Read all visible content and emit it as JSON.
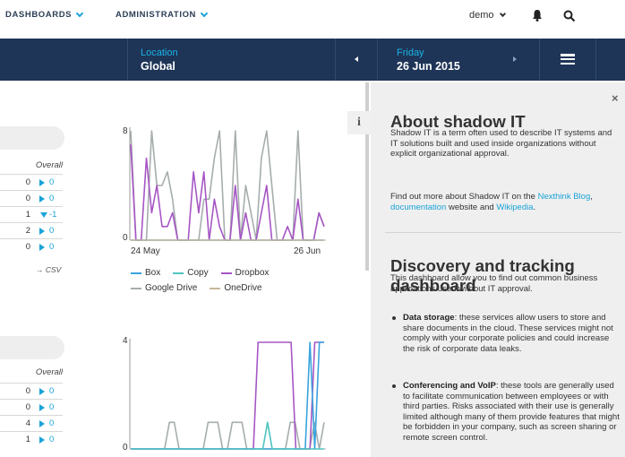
{
  "topnav": {
    "dashboards": "DASHBOARDS",
    "administration": "ADMINISTRATION",
    "user": "demo"
  },
  "header": {
    "location_label": "Location",
    "location_value": "Global",
    "date_day": "Friday",
    "date_value": "26 Jun 2015"
  },
  "table1": {
    "overall": "Overall",
    "rows": [
      {
        "value": "0",
        "dir": "right",
        "delta": "0"
      },
      {
        "value": "0",
        "dir": "right",
        "delta": "0"
      },
      {
        "value": "1",
        "dir": "down",
        "delta": "-1"
      },
      {
        "value": "2",
        "dir": "right",
        "delta": "0"
      },
      {
        "value": "0",
        "dir": "right",
        "delta": "0"
      }
    ],
    "csv": "→ CSV"
  },
  "table2": {
    "overall": "Overall",
    "rows": [
      {
        "value": "0",
        "dir": "right",
        "delta": "0"
      },
      {
        "value": "0",
        "dir": "right",
        "delta": "0"
      },
      {
        "value": "4",
        "dir": "right",
        "delta": "0"
      },
      {
        "value": "1",
        "dir": "right",
        "delta": "0"
      }
    ]
  },
  "chart1": {
    "y_max_label": "8",
    "y_min_label": "0",
    "x_start_label": "24 May",
    "x_end_label": "26 Jun",
    "legend": [
      {
        "name": "Box",
        "color": "#3aa3dd"
      },
      {
        "name": "Copy",
        "color": "#4ec3c0"
      },
      {
        "name": "Dropbox",
        "color": "#a656c4"
      },
      {
        "name": "Google Drive",
        "color": "#a6adad"
      },
      {
        "name": "OneDrive",
        "color": "#c8b69a"
      }
    ]
  },
  "chart2": {
    "y_max_label": "4",
    "y_min_label": "0"
  },
  "chart_data": [
    {
      "type": "line",
      "xlabel": "",
      "ylabel": "",
      "x": [
        "24 May",
        "26 Jun"
      ],
      "ylim": [
        0,
        8
      ],
      "series": [
        {
          "name": "Google Drive",
          "values": [
            8,
            0,
            0,
            0,
            8,
            4,
            4,
            5,
            3,
            0,
            0,
            0,
            0,
            0,
            3,
            3,
            6,
            8,
            0,
            0,
            8,
            0,
            4,
            2,
            0,
            6,
            8,
            4,
            0,
            0,
            0,
            0,
            8,
            0,
            0,
            0,
            2,
            1
          ]
        },
        {
          "name": "Dropbox",
          "values": [
            7,
            0,
            0,
            6,
            2,
            4,
            1,
            1,
            2,
            0,
            0,
            0,
            5,
            2,
            5,
            0,
            3,
            1,
            0,
            0,
            4,
            0,
            2,
            0,
            0,
            2,
            4,
            0,
            0,
            0,
            1,
            0,
            3,
            0,
            0,
            0,
            2,
            1
          ]
        },
        {
          "name": "Box",
          "values": [
            0,
            0,
            0,
            0,
            0,
            0,
            0,
            0,
            0,
            0,
            0,
            0,
            0,
            0,
            0,
            0,
            0,
            0,
            0,
            0,
            0,
            0,
            0,
            0,
            0,
            0,
            0,
            0,
            0,
            0,
            0,
            0,
            0,
            0,
            0,
            0,
            0,
            0
          ]
        },
        {
          "name": "OneDrive",
          "values": [
            0,
            0,
            0,
            0,
            0,
            0,
            0,
            0,
            0,
            0,
            0,
            0,
            0,
            0,
            0,
            0,
            0,
            0,
            0,
            0,
            0,
            0,
            0,
            0,
            0,
            0,
            0,
            0,
            0,
            0,
            0,
            0,
            0,
            0,
            0,
            0,
            0,
            0
          ]
        }
      ]
    },
    {
      "type": "line",
      "xlabel": "",
      "ylabel": "",
      "ylim": [
        0,
        4
      ],
      "series": [
        {
          "name": "Google Drive",
          "values": [
            0,
            0,
            0,
            0,
            0,
            0,
            0,
            0,
            1,
            1,
            0,
            0,
            0,
            0,
            0,
            0,
            1,
            1,
            1,
            0,
            0,
            1,
            1,
            1,
            0,
            0,
            0,
            0,
            0,
            0,
            0,
            0,
            0,
            1,
            1,
            0,
            0,
            0,
            1,
            0,
            1
          ]
        },
        {
          "name": "Dropbox",
          "values": [
            0,
            0,
            0,
            0,
            0,
            0,
            0,
            0,
            0,
            0,
            0,
            0,
            0,
            0,
            0,
            0,
            0,
            0,
            0,
            0,
            0,
            0,
            0,
            0,
            0,
            0,
            0,
            4,
            4,
            4,
            4,
            4,
            4,
            4,
            4,
            0,
            0,
            0,
            0,
            4,
            4,
            4
          ]
        },
        {
          "name": "Box",
          "values": [
            0,
            0,
            0,
            0,
            0,
            0,
            0,
            0,
            0,
            0,
            0,
            0,
            0,
            0,
            0,
            0,
            0,
            0,
            0,
            0,
            0,
            0,
            0,
            0,
            0,
            0,
            0,
            0,
            0,
            0,
            0,
            0,
            0,
            0,
            0,
            0,
            0,
            0,
            4,
            0,
            4,
            4
          ]
        },
        {
          "name": "Copy",
          "values": [
            0,
            0,
            0,
            0,
            0,
            0,
            0,
            0,
            0,
            0,
            0,
            0,
            0,
            0,
            0,
            0,
            0,
            0,
            0,
            0,
            0,
            0,
            0,
            0,
            0,
            0,
            0,
            0,
            0,
            1,
            0,
            0,
            0,
            0,
            0,
            0,
            0,
            0,
            0,
            0,
            0,
            0
          ]
        }
      ]
    }
  ],
  "panel": {
    "title1": "About shadow IT",
    "p1": "Shadow IT is a term often used to describe IT systems and IT solutions built and used inside organizations without explicit organizational approval.",
    "p2_prefix": "Find out more about Shadow IT on the ",
    "p2_link1": "Nexthink Blog",
    "p2_sep": ", ",
    "p2_link2": "documentation",
    "p2_mid": " website and ",
    "p2_link3": "Wikipedia",
    "p2_end": ".",
    "title2": "Discovery and tracking dashboard",
    "p3": "This dashboard allow you to find out common business applications used without IT approval.",
    "b1_title": "Data storage",
    "b1_text": ": these services allow users to store and share documents in the cloud. These services might not comply with your corporate policies and could increase the risk of corporate data leaks.",
    "b2_title": "Conferencing and VoIP",
    "b2_text": ": these tools are generally used to facilitate communication between employees or with third parties. Risks associated with their use is generally limited although many of them provide features that might be forbidden in your company, such as screen sharing or remote screen control."
  }
}
